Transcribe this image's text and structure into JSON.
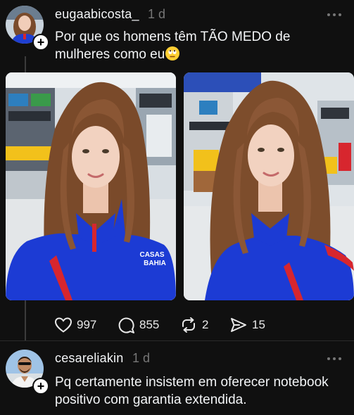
{
  "post": {
    "username": "eugaabicosta_",
    "time": "1 d",
    "text": "Por que os homens têm TÃO MEDO de mulheres como eu",
    "emoji": "🙄",
    "images": [
      {
        "alt": "selfie-in-electronics-store-left",
        "shirt_text_line1": "CASAS",
        "shirt_text_line2": "BAHIA"
      },
      {
        "alt": "selfie-in-electronics-store-right"
      }
    ],
    "stats": {
      "likes": "997",
      "comments": "855",
      "reposts": "2",
      "shares": "15"
    }
  },
  "reply": {
    "username": "cesareliakin",
    "time": "1 d",
    "text_line1": "Pq certamente insistem em oferecer notebook",
    "text_line2": "positivo com garantia extendida."
  },
  "colors": {
    "background": "#101010",
    "text": "#f3f5f7",
    "muted": "#777777",
    "shirt_blue": "#1c3bd4",
    "shirt_red": "#d7262e"
  },
  "icons": [
    "heart-icon",
    "comment-icon",
    "repost-icon",
    "share-icon",
    "more-icon",
    "follow-plus-icon"
  ]
}
